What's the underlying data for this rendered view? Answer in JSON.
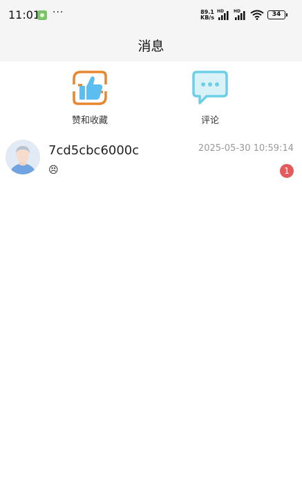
{
  "status_bar": {
    "time": "11:01",
    "dots": "···",
    "speed_value": "89.1",
    "speed_unit": "KB/s",
    "hd1": "HD",
    "hd2": "HD",
    "battery": "34"
  },
  "header": {
    "title": "消息"
  },
  "categories": [
    {
      "label": "赞和收藏",
      "icon": "thumbs-up-icon",
      "color": "#e8862f",
      "accent": "#5bbdf0"
    },
    {
      "label": "评论",
      "icon": "chat-bubble-icon",
      "color": "#6ccfe5"
    }
  ],
  "messages": [
    {
      "name": "7cd5cbc6000c",
      "preview": "😣",
      "time": "2025-05-30 10:59:14",
      "unread": "1"
    }
  ]
}
